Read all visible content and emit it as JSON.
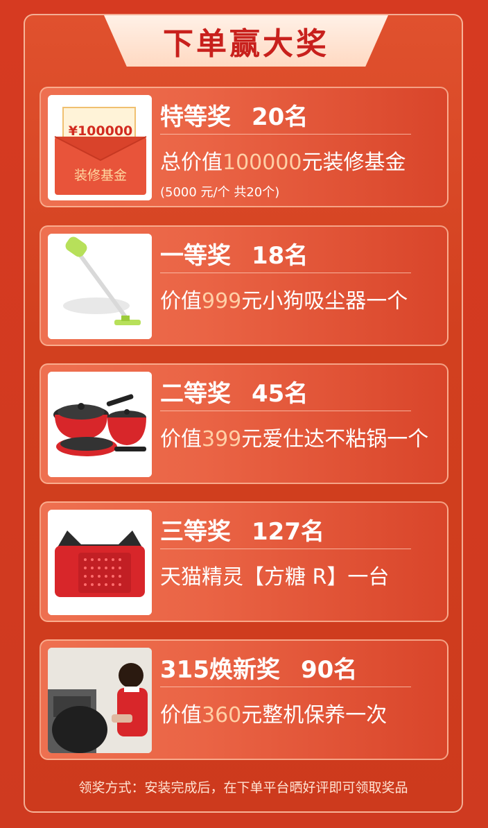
{
  "header": {
    "title": "下单赢大奖"
  },
  "prizes": [
    {
      "level": "特等奖",
      "count": "20名",
      "desc_pre": "总价值",
      "desc_hl": "100000",
      "desc_post": "元装修基金",
      "note": "(5000 元/个 共20个)",
      "image": {
        "amount": "¥100000",
        "label": "装修基金"
      }
    },
    {
      "level": "一等奖",
      "count": "18名",
      "desc_pre": "价值",
      "desc_hl": "999",
      "desc_post": "元小狗吸尘器一个"
    },
    {
      "level": "二等奖",
      "count": "45名",
      "desc_pre": "价值",
      "desc_hl": "399",
      "desc_post": "元爱仕达不粘锅一个"
    },
    {
      "level": "三等奖",
      "count": "127名",
      "desc_pre": "",
      "desc_hl": "",
      "desc_post": "天猫精灵【方糖 R】一台"
    },
    {
      "level": "315焕新奖",
      "count": "90名",
      "desc_pre": "价值",
      "desc_hl": "360",
      "desc_post": "元整机保养一次"
    }
  ],
  "footer": {
    "text": "领奖方式：安装完成后，在下单平台晒好评即可领取奖品"
  }
}
